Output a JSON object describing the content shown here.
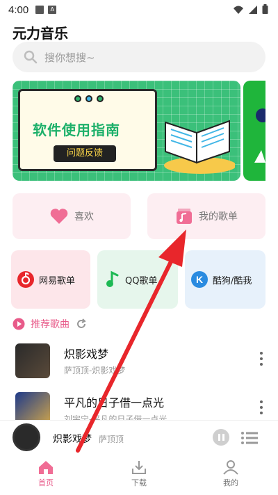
{
  "status": {
    "time": "4:00"
  },
  "app": {
    "title": "元力音乐"
  },
  "search": {
    "placeholder": "搜你想搜~"
  },
  "banner": {
    "title": "软件使用指南",
    "pill": "问题反馈"
  },
  "quick": {
    "like": "喜欢",
    "my_list": "我的歌单"
  },
  "sources": [
    {
      "label": "网易歌单"
    },
    {
      "label": "QQ歌单"
    },
    {
      "label": "酷狗/酷我"
    }
  ],
  "recommend": {
    "title": "推荐歌曲"
  },
  "songs": [
    {
      "title": "炽影戏梦",
      "subtitle": "萨顶顶-炽影戏梦"
    },
    {
      "title": "平凡的日子借一点光",
      "subtitle": "刘宇宁-平凡的日子借一点光"
    }
  ],
  "player": {
    "title": "炽影戏梦",
    "artist": "萨顶顶"
  },
  "nav": {
    "home": "首页",
    "download": "下载",
    "mine": "我的"
  },
  "colors": {
    "accent": "#e85b8a",
    "arrow": "#e8262b",
    "banner_green": "#3bc07a"
  },
  "icons": {
    "search": "search-icon",
    "heart": "heart-icon",
    "playlist": "playlist-icon",
    "netease": "netease-icon",
    "qq": "qq-music-icon",
    "kugou": "kugou-icon",
    "refresh": "refresh-icon",
    "more": "more-icon",
    "pause": "pause-icon",
    "queue": "queue-icon",
    "home": "home-icon",
    "download": "download-icon",
    "user": "user-icon"
  }
}
